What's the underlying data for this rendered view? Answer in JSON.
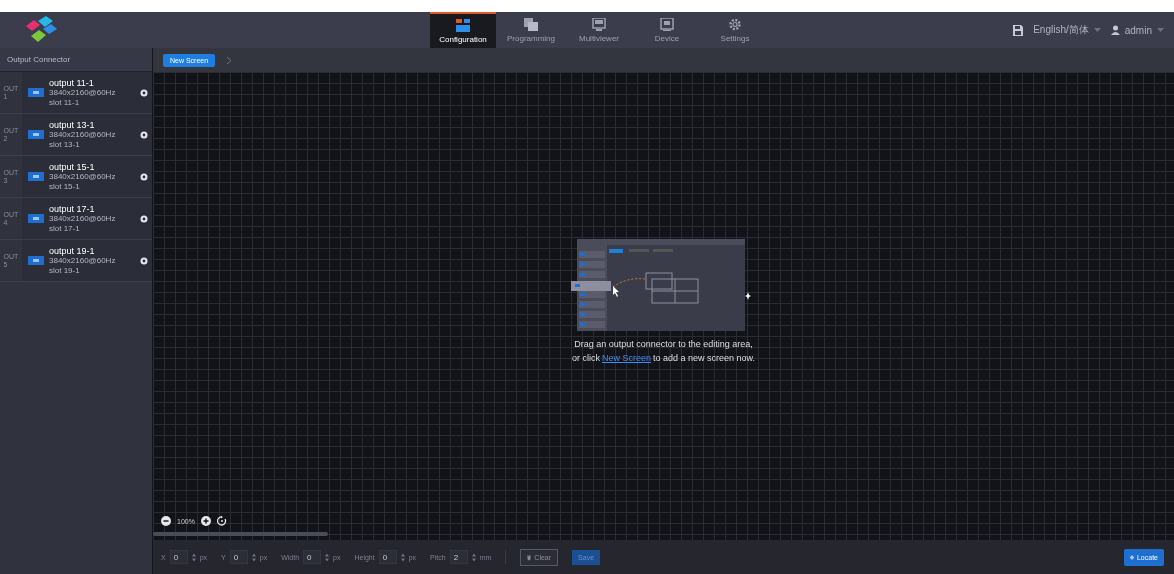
{
  "header": {
    "nav": [
      {
        "label": "Configuration",
        "kind": "config",
        "selected": true
      },
      {
        "label": "Programming",
        "kind": "program",
        "selected": false
      },
      {
        "label": "Multiviewer",
        "kind": "multi",
        "selected": false
      },
      {
        "label": "Device",
        "kind": "device",
        "selected": false
      },
      {
        "label": "Settings",
        "kind": "settings",
        "selected": false
      }
    ],
    "language": "English/简体",
    "user": "admin"
  },
  "sidebar": {
    "title": "Output Connector",
    "items": [
      {
        "port": "OUT",
        "index": "1",
        "name": "output 11-1",
        "resolution": "3840x2160@60Hz",
        "slot": "slot 11-1"
      },
      {
        "port": "OUT",
        "index": "2",
        "name": "output 13-1",
        "resolution": "3840x2160@60Hz",
        "slot": "slot 13-1"
      },
      {
        "port": "OUT",
        "index": "3",
        "name": "output 15-1",
        "resolution": "3840x2160@60Hz",
        "slot": "slot 15-1"
      },
      {
        "port": "OUT",
        "index": "4",
        "name": "output 17-1",
        "resolution": "3840x2160@60Hz",
        "slot": "slot 17-1"
      },
      {
        "port": "OUT",
        "index": "5",
        "name": "output 19-1",
        "resolution": "3840x2160@60Hz",
        "slot": "slot 19-1"
      }
    ]
  },
  "toolbar": {
    "new_screen": "New Screen"
  },
  "hint": {
    "line1": "Drag an output connector to the editing area,",
    "before": "or click",
    "link": "New Screen",
    "after": "to add a new screen now."
  },
  "zoom": {
    "value": "100%"
  },
  "bottom": {
    "fields": [
      {
        "label": "X",
        "value": "0",
        "unit": "px"
      },
      {
        "label": "Y",
        "value": "0",
        "unit": "px"
      },
      {
        "label": "Width",
        "value": "0",
        "unit": "px"
      },
      {
        "label": "Height",
        "value": "0",
        "unit": "px"
      },
      {
        "label": "Pitch",
        "value": "2",
        "unit": "mm"
      }
    ],
    "clear": "Clear",
    "save": "Save",
    "locate": "Locate"
  }
}
